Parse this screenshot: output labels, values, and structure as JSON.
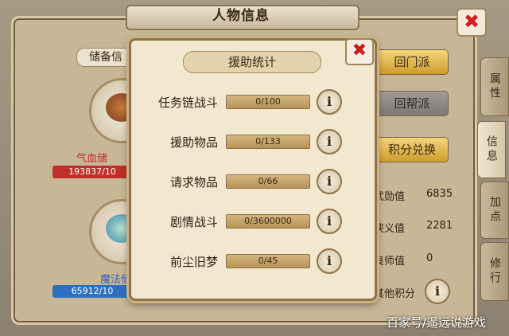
{
  "window": {
    "title": "人物信息",
    "close_glyph": "✖"
  },
  "side_tabs": [
    "属性",
    "信息",
    "加点",
    "修行"
  ],
  "left": {
    "storage_label": "储备信",
    "hp_label": "气血储",
    "hp_value": "193837/10",
    "mp_label": "魔法储",
    "mp_value": "65912/10"
  },
  "right_buttons": {
    "sect": "回门派",
    "guild": "回帮派",
    "exchange": "积分兑换"
  },
  "right_stats": [
    {
      "label": "武勋值",
      "value": "6835"
    },
    {
      "label": "侠义值",
      "value": "2281"
    },
    {
      "label": "良师值",
      "value": "0"
    },
    {
      "label": "其他积分",
      "value": ""
    }
  ],
  "popup": {
    "title": "援助统计",
    "close_glyph": "✖",
    "info_glyph": "i",
    "rows": [
      {
        "label": "任务链战斗",
        "value": "0/100"
      },
      {
        "label": "援助物品",
        "value": "0/133"
      },
      {
        "label": "请求物品",
        "value": "0/66"
      },
      {
        "label": "剧情战斗",
        "value": "0/3600000"
      },
      {
        "label": "前尘旧梦",
        "value": "0/45"
      }
    ]
  },
  "watermark": "百家号/遥远说游戏",
  "colors": {
    "hp_bar": "#c0302a",
    "mp_bar": "#2f6fbf",
    "accent_gold": "#cf9b2c"
  }
}
